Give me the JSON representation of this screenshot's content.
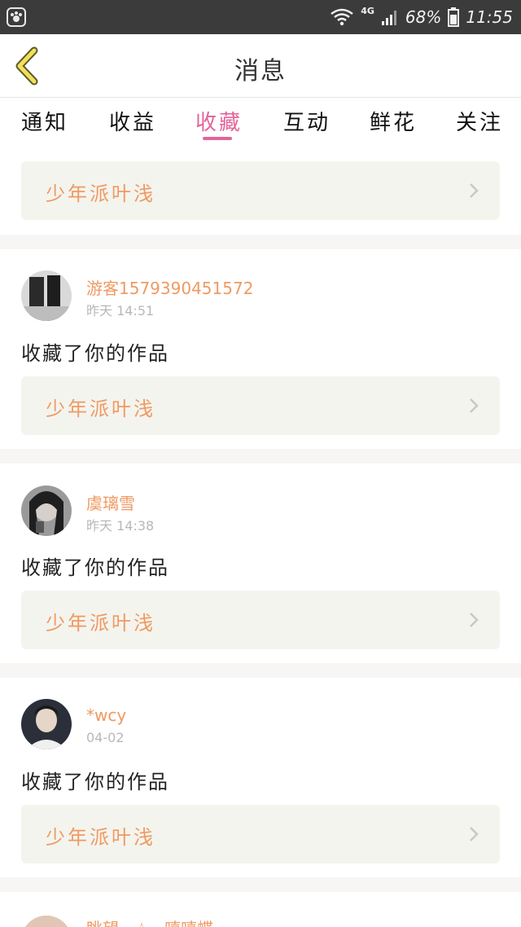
{
  "status_bar": {
    "network": "4G",
    "battery": "68%",
    "time": "11:55",
    "icons": [
      "app-icon",
      "wifi-icon",
      "signal-icon",
      "battery-icon"
    ]
  },
  "header": {
    "title": "消息"
  },
  "tabs": [
    {
      "label": "通知"
    },
    {
      "label": "收益"
    },
    {
      "label": "收藏",
      "active": true
    },
    {
      "label": "互动"
    },
    {
      "label": "鲜花"
    },
    {
      "label": "关注"
    }
  ],
  "first_item": {
    "work_title": "少年派叶浅"
  },
  "items": [
    {
      "user": "游客1579390451572",
      "time": "昨天 14:51",
      "action": "收藏了你的作品",
      "work_title": "少年派叶浅"
    },
    {
      "user": "虞璃雪",
      "time": "昨天 14:38",
      "action": "收藏了你的作品",
      "work_title": "少年派叶浅"
    },
    {
      "user": "*wcy",
      "time": "04-02",
      "action": "收藏了你的作品",
      "work_title": "少年派叶浅"
    },
    {
      "user": "眺望 · ☆ · 嘻嘻蝶"
    }
  ],
  "colors": {
    "accent_pink": "#e4639a",
    "username_orange": "#ef9a63",
    "work_box_bg": "#f4f4ee",
    "divider": "#f7f6f4"
  }
}
